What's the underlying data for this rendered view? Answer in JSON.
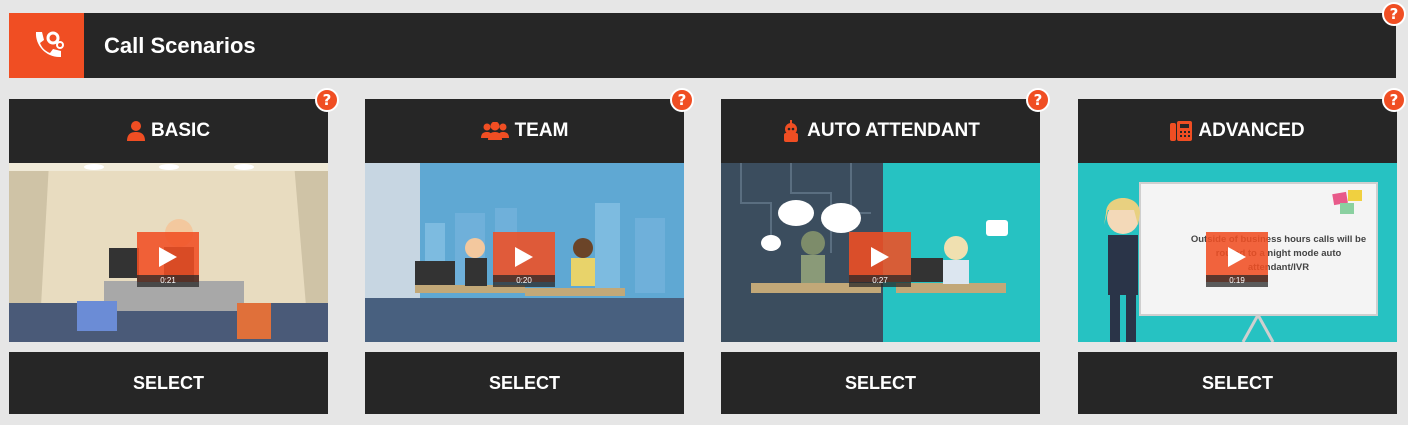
{
  "header": {
    "title": "Call Scenarios",
    "icon": "phone-gear-icon",
    "help": "?"
  },
  "accent": "#f04e23",
  "cards": [
    {
      "title": "BASIC",
      "icon": "user-icon",
      "duration": "0:21",
      "select": "SELECT",
      "help": "?"
    },
    {
      "title": "TEAM",
      "icon": "users-icon",
      "duration": "0:20",
      "select": "SELECT",
      "help": "?"
    },
    {
      "title": "AUTO ATTENDANT",
      "icon": "robot-icon",
      "duration": "0:27",
      "select": "SELECT",
      "help": "?"
    },
    {
      "title": "ADVANCED",
      "icon": "fax-phone-icon",
      "duration": "0:19",
      "select": "SELECT",
      "help": "?",
      "slide_text": "Outside of business hours calls will be routed to a night mode auto attendant/IVR"
    }
  ]
}
